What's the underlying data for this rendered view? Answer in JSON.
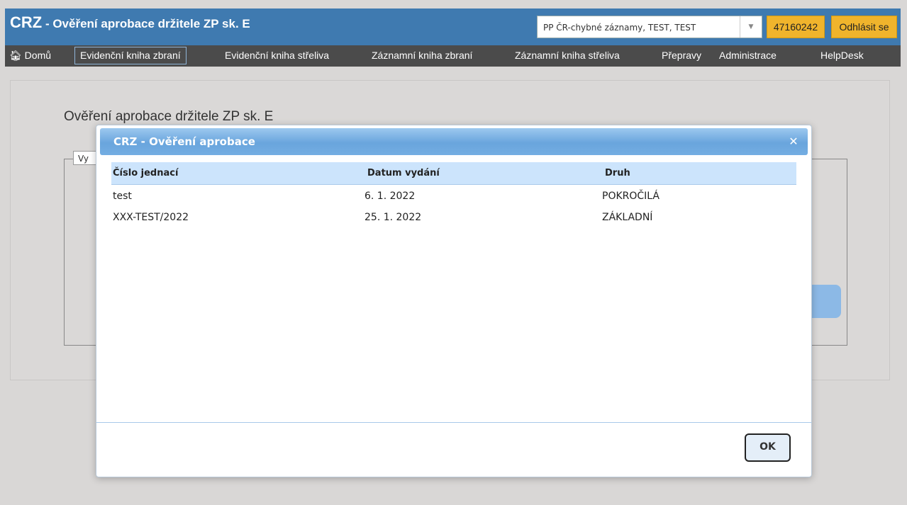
{
  "header": {
    "brand": "CRZ",
    "subtitle": " - Ověření aprobace držitele ZP sk. E",
    "org_select_value": "PP ČR-chybné záznamy, TEST, TEST",
    "user_id": "47160242",
    "logout_label": "Odhlásit se"
  },
  "nav": {
    "home": "Domů",
    "items": [
      "Evidenční kniha zbraní",
      "Evidenční kniha střeliva",
      "Záznamní kniha zbraní",
      "Záznamní kniha střeliva",
      "Přepravy",
      "Administrace",
      "HelpDesk"
    ]
  },
  "page": {
    "title": "Ověření aprobace držitele ZP sk. E",
    "fieldset_legend": "Vy"
  },
  "modal": {
    "title": "CRZ - Ověření aprobace",
    "columns": [
      "Číslo jednací",
      "Datum vydání",
      "Druh"
    ],
    "rows": [
      [
        "test",
        "6. 1. 2022",
        "POKROČILÁ"
      ],
      [
        "XXX-TEST/2022",
        "25. 1. 2022",
        "ZÁKLADNÍ"
      ]
    ],
    "ok_label": "OK"
  }
}
